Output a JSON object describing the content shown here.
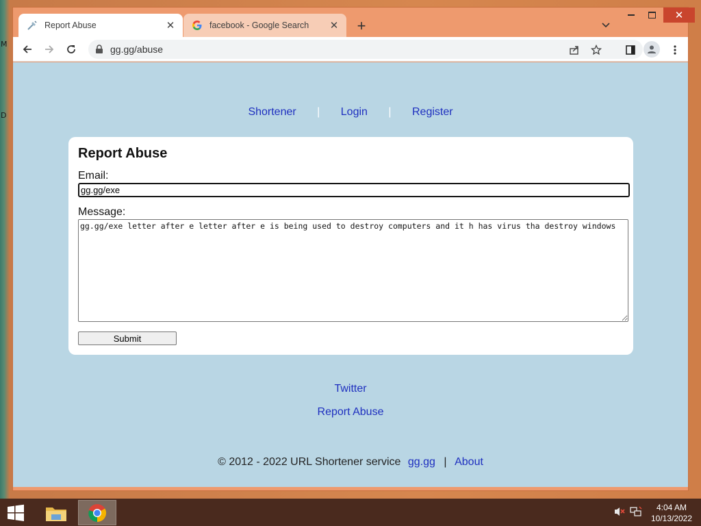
{
  "desktop": {
    "edge_letters": [
      "M",
      "D"
    ]
  },
  "browser": {
    "tabs": [
      {
        "title": "Report Abuse",
        "active": true
      },
      {
        "title": "facebook - Google Search",
        "active": false
      }
    ],
    "url": "gg.gg/abuse"
  },
  "page": {
    "nav": {
      "items": [
        "Shortener",
        "Login",
        "Register"
      ],
      "separator": "|"
    },
    "form": {
      "heading": "Report Abuse",
      "email_label": "Email:",
      "email_value": "gg.gg/exe",
      "message_label": "Message:",
      "message_value": "gg.gg/exe letter after e letter after e is being used to destroy computers and it h has virus tha destroy windows",
      "submit_label": "Submit"
    },
    "footer": {
      "links": [
        "Twitter",
        "Report Abuse"
      ],
      "copyright_text": "© 2012 - 2022 URL Shortener service",
      "domain_link": "gg.gg",
      "separator": "|",
      "about_link": "About"
    }
  },
  "taskbar": {
    "time": "4:04 AM",
    "date": "10/13/2022"
  },
  "colors": {
    "page_bg": "#b9d6e4",
    "link": "#1e2fbf",
    "tabstrip": "#ee9a6e",
    "taskbar": "#4a2a1e"
  }
}
